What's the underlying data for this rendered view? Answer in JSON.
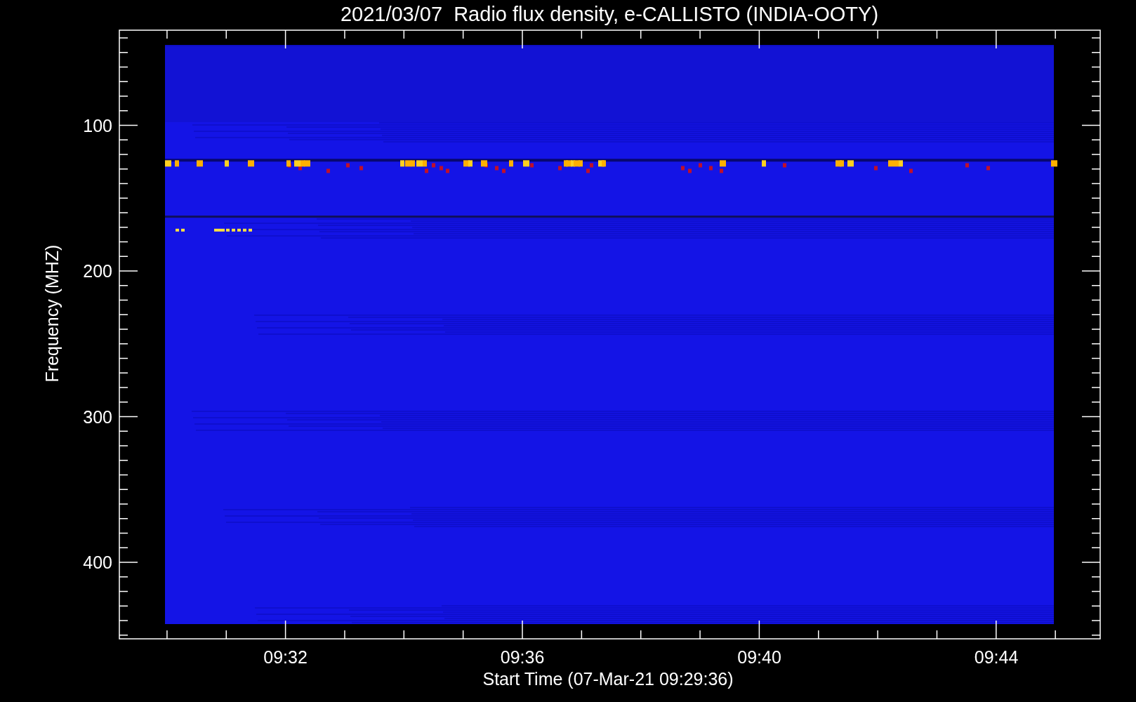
{
  "title": "2021/03/07  Radio flux density, e-CALLISTO (INDIA-OOTY)",
  "ylabel": "Frequency (MHZ)",
  "xlabel": "Start Time (07-Mar-21 09:29:36)",
  "yticks": [
    "100",
    "200",
    "300",
    "400"
  ],
  "xticks": [
    "09:32",
    "09:36",
    "09:40",
    "09:44"
  ]
}
